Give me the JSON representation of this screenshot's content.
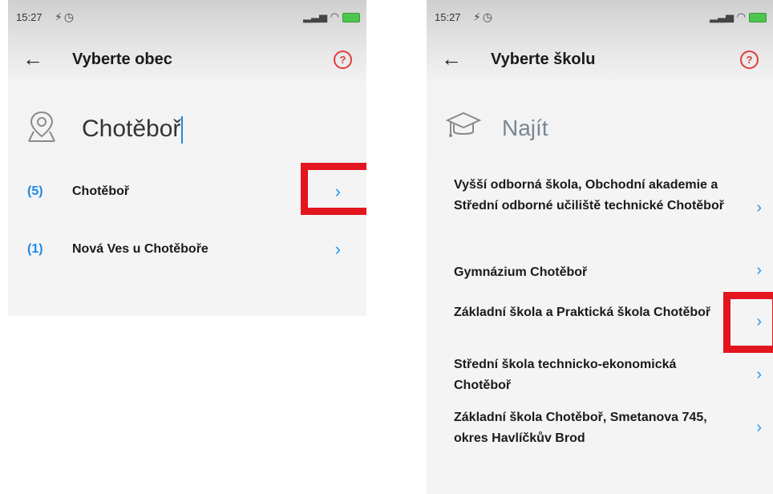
{
  "left_screen": {
    "status_time": "15:27",
    "title": "Vyberte obec",
    "help_label": "?",
    "search_value": "Chotěboř",
    "results": [
      {
        "count": "(5)",
        "name": "Chotěboř"
      },
      {
        "count": "(1)",
        "name": "Nová Ves u Chotěboře"
      }
    ]
  },
  "right_screen": {
    "status_time": "15:27",
    "title": "Vyberte školu",
    "help_label": "?",
    "search_placeholder": "Najít",
    "schools": [
      {
        "name": "Vyšší odborná škola, Obchodní akademie a Střední odborné učiliště technické Chotěboř"
      },
      {
        "name": "Gymnázium Chotěboř"
      },
      {
        "name": "Základní škola a Praktická škola Chotěboř"
      },
      {
        "name": "Střední škola technicko-ekonomická Chotěboř"
      },
      {
        "name": "Základní škola Chotěboř, Smetanova 745, okres Havlíčkův Brod"
      }
    ]
  },
  "icons": {
    "back": "←",
    "chevron": "›",
    "location": "map-pin-icon",
    "school": "graduation-cap-icon"
  },
  "colors": {
    "accent": "#1e88e5",
    "highlight": "#e3151e",
    "help": "#e23b3b"
  }
}
